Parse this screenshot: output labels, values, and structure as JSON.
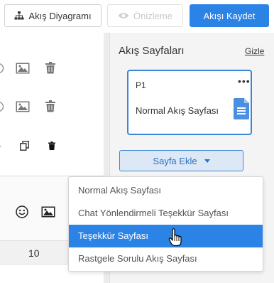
{
  "toolbar": {
    "diagram_label": "Akış Diyagramı",
    "preview_label": "Önizleme",
    "save_label": "Akışı Kaydet",
    "diagram_icon": "sitemap-icon",
    "preview_icon": "eye-icon"
  },
  "left": {
    "row_icons": [
      "radio-icon",
      "image-icon",
      "trash-icon"
    ],
    "row3_icons": [
      "copy-icon",
      "trash-icon"
    ],
    "lower_icons": [
      "smiley-icon",
      "image-icon"
    ],
    "number_cell": "10"
  },
  "panel": {
    "title": "Akış Sayfaları",
    "hide_link": "Gizle",
    "page_card": {
      "id": "P1",
      "name": "Normal Akış Sayfası",
      "more": "•••",
      "icon": "document-icon"
    },
    "add_page_label": "Sayfa Ekle"
  },
  "dropdown": {
    "items": [
      "Normal Akış Sayfası",
      "Chat Yönlendirmeli Teşekkür Sayfası",
      "Teşekkür Sayfası",
      "Rastgele Sorulu Akış Sayfası"
    ],
    "selected": "Teşekkür Sayfası"
  },
  "colors": {
    "accent": "#2c83e6",
    "card_border": "#3a86d8",
    "doc_icon": "#4a8fe0"
  }
}
